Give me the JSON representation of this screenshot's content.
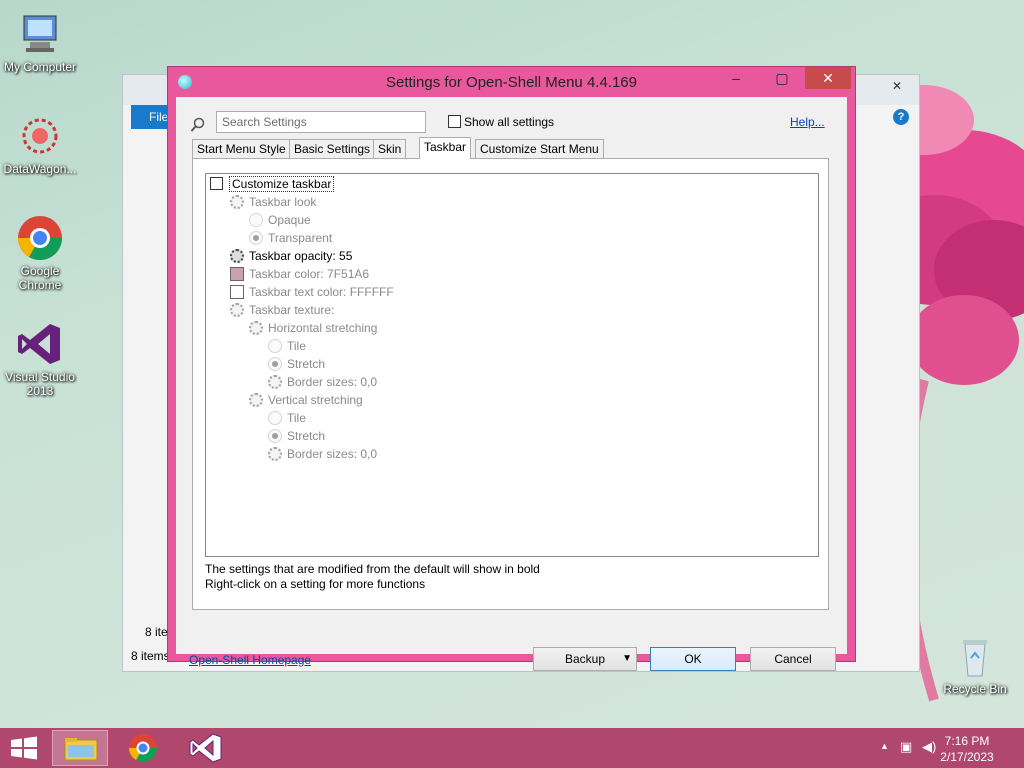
{
  "desktop": {
    "icons": [
      {
        "label": "My Computer",
        "icon": "computer-icon"
      },
      {
        "label": "DataWagon...",
        "icon": "datawagon-icon"
      },
      {
        "label": "Google Chrome",
        "icon": "chrome-icon"
      },
      {
        "label": "Visual Studio 2013",
        "icon": "visual-studio-icon"
      },
      {
        "label": "Recycle Bin",
        "icon": "recycle-bin-icon"
      }
    ]
  },
  "explorer": {
    "ribbon_tab": "File",
    "status_items": "8 items",
    "status_items_partial": "8 item"
  },
  "dialog": {
    "title": "Settings for Open-Shell Menu 4.4.169",
    "search_placeholder": "Search Settings",
    "show_all_label": "Show all settings",
    "help_link": "Help...",
    "tabs": [
      {
        "label": "Start Menu Style"
      },
      {
        "label": "Basic Settings"
      },
      {
        "label": "Skin"
      },
      {
        "label": "Taskbar"
      },
      {
        "label": "Customize Start Menu"
      }
    ],
    "active_tab": "Taskbar",
    "tree": [
      {
        "label": "Customize taskbar",
        "kind": "checkbox"
      },
      {
        "label": "Taskbar look",
        "kind": "gear"
      },
      {
        "label": "Opaque",
        "kind": "radio"
      },
      {
        "label": "Transparent",
        "kind": "radio-on"
      },
      {
        "label": "Taskbar opacity: 55",
        "kind": "gear-dark"
      },
      {
        "label": "Taskbar color: 7F51A6",
        "kind": "swatch",
        "color": "#c9a0ab"
      },
      {
        "label": "Taskbar text color: FFFFFF",
        "kind": "swatch",
        "color": "#ffffff"
      },
      {
        "label": "Taskbar texture:",
        "kind": "gear"
      },
      {
        "label": "Horizontal stretching",
        "kind": "gear"
      },
      {
        "label": "Tile",
        "kind": "radio"
      },
      {
        "label": "Stretch",
        "kind": "radio-on"
      },
      {
        "label": "Border sizes: 0,0",
        "kind": "gear"
      },
      {
        "label": "Vertical stretching",
        "kind": "gear"
      },
      {
        "label": "Tile",
        "kind": "radio"
      },
      {
        "label": "Stretch",
        "kind": "radio-on"
      },
      {
        "label": "Border sizes: 0,0",
        "kind": "gear"
      }
    ],
    "hint_line1": "The settings that are modified from the default will show in bold",
    "hint_line2": "Right-click on a setting for more functions",
    "homepage_link": "Open-Shell Homepage",
    "backup_label": "Backup",
    "ok_label": "OK",
    "cancel_label": "Cancel"
  },
  "taskbar": {
    "color": "#b0476c",
    "time": "7:16 PM",
    "date": "2/17/2023"
  }
}
